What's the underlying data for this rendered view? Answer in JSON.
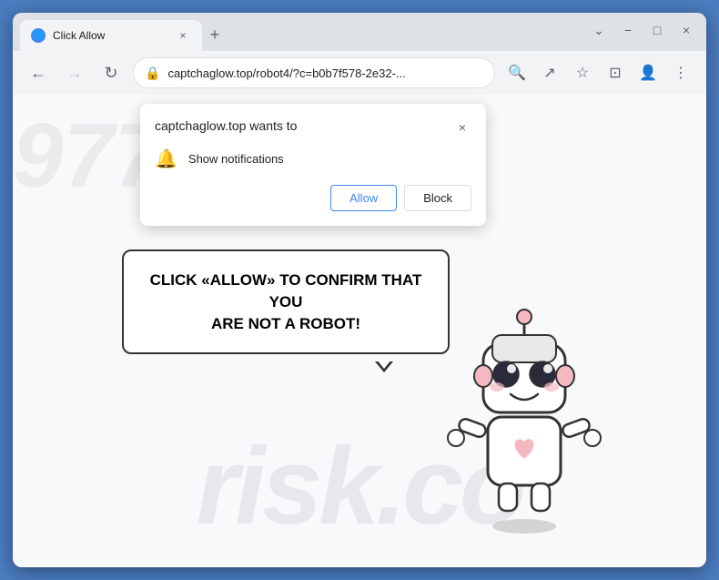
{
  "window": {
    "title": "Click Allow",
    "close_label": "×",
    "minimize_label": "−",
    "maximize_label": "□",
    "dropdown_label": "⌄"
  },
  "tab": {
    "title": "Click Allow",
    "close_btn": "×",
    "new_tab_btn": "+"
  },
  "nav": {
    "back_btn": "←",
    "forward_btn": "→",
    "refresh_btn": "↻",
    "url": "captchaglow.top/robot4/?c=b0b7f578-2e32-...",
    "lock_icon": "🔒",
    "search_icon": "🔍",
    "share_icon": "↗",
    "bookmark_icon": "☆",
    "extensions_icon": "⊡",
    "profile_icon": "👤",
    "menu_icon": "⋮"
  },
  "popup": {
    "title": "captchaglow.top wants to",
    "close_btn": "×",
    "notification_text": "Show notifications",
    "allow_label": "Allow",
    "block_label": "Block"
  },
  "page": {
    "main_text_line1": "CLICK «ALLOW» TO CONFIRM THAT YOU",
    "main_text_line2": "ARE NOT A ROBOT!",
    "watermark": "risk.co"
  }
}
